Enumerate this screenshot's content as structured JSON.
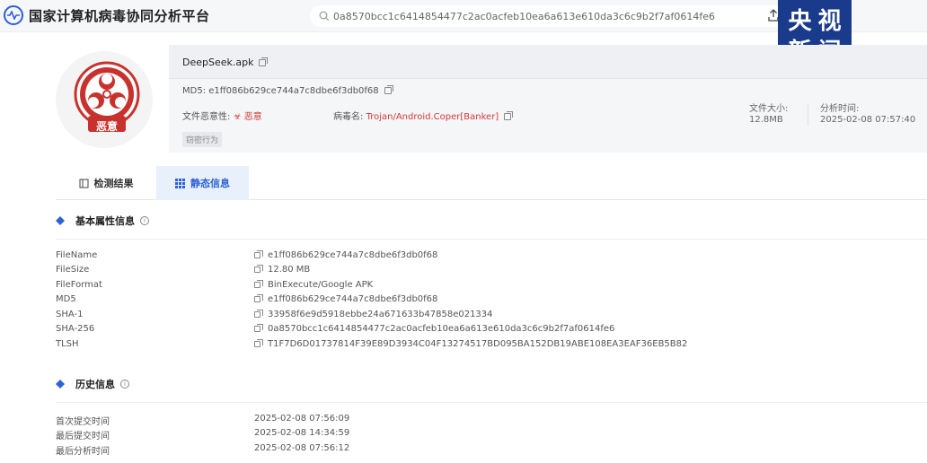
{
  "app": {
    "title": "国家计算机病毒协同分析平台"
  },
  "search": {
    "value": "0a8570bcc1c6414854477c2ac0acfeb10ea6a613e610da3c6c9b2f7af0614fe6"
  },
  "watermark": {
    "chars": [
      "央",
      "视",
      "新",
      "闻"
    ]
  },
  "summary": {
    "file_name": "DeepSeek.apk",
    "md5_label": "MD5:",
    "md5": "e1ff086b629ce744a7c8dbe6f3db0f68",
    "malicious_label": "文件恶意性:",
    "malicious_value": "恶意",
    "badge_text": "恶意",
    "virus_label": "病毒名:",
    "virus_value": "Trojan/Android.Coper[Banker]",
    "tag": "窃密行为",
    "size_label": "文件大小:",
    "size_value": "12.8MB",
    "time_label": "分析时间:",
    "time_value": "2025-02-08 07:57:40"
  },
  "tabs": [
    {
      "label": "检测结果",
      "active": false
    },
    {
      "label": "静态信息",
      "active": true
    }
  ],
  "basic": {
    "title": "基本属性信息",
    "rows": [
      {
        "key": "FileName",
        "value": "e1ff086b629ce744a7c8dbe6f3db0f68"
      },
      {
        "key": "FileSize",
        "value": "12.80 MB"
      },
      {
        "key": "FileFormat",
        "value": "BinExecute/Google APK"
      },
      {
        "key": "MD5",
        "value": "e1ff086b629ce744a7c8dbe6f3db0f68"
      },
      {
        "key": "SHA-1",
        "value": "33958f6e9d5918ebbe24a671633b47858e021334"
      },
      {
        "key": "SHA-256",
        "value": "0a8570bcc1c6414854477c2ac0acfeb10ea6a613e610da3c6c9b2f7af0614fe6"
      },
      {
        "key": "TLSH",
        "value": "T1F7D6D01737814F39E89D3934C04F13274517BD095BA152DB19ABE108EA3EAF36EB5B82"
      }
    ]
  },
  "history": {
    "title": "历史信息",
    "rows": [
      {
        "key": "首次提交时间",
        "value": "2025-02-08 07:56:09"
      },
      {
        "key": "最后提交时间",
        "value": "2025-02-08 14:34:59"
      },
      {
        "key": "最后分析时间",
        "value": "2025-02-08 07:56:12"
      }
    ]
  },
  "colors": {
    "accent": "#2e63d4",
    "danger": "#d23a3a",
    "watermark_bg": "#1a3a8c"
  }
}
